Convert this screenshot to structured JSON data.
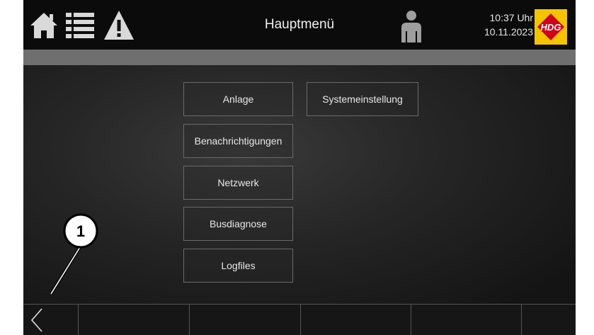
{
  "header": {
    "title": "Hauptmenü",
    "time": "10:37 Uhr",
    "date": "10.11.2023",
    "logo_text": "HDG",
    "brand_color": "#f5c400",
    "logo_accent": "#d0021b"
  },
  "menu": {
    "anlage": "Anlage",
    "systemeinstellung": "Systemeinstellung",
    "benachrichtigungen": "Benachrichtigungen",
    "netzwerk": "Netzwerk",
    "busdiagnose": "Busdiagnose",
    "logfiles": "Logfiles"
  },
  "icons": {
    "home": "home-icon",
    "menu": "list-icon",
    "alert": "warning-icon",
    "user": "user-icon",
    "back": "chevron-left-icon"
  },
  "callout": {
    "number": "1"
  }
}
